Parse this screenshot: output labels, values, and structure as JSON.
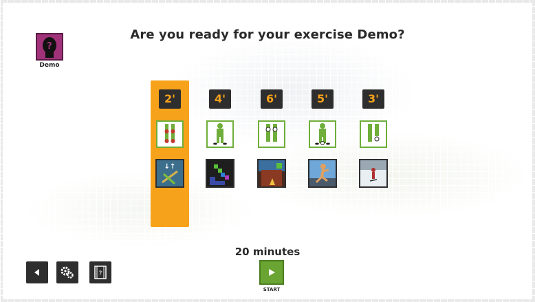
{
  "profile": {
    "name": "Demo",
    "avatar_color": "#a0327a",
    "avatar_icon": "question-head-icon"
  },
  "title": "Are you ready for your exercise Demo?",
  "columns": [
    {
      "duration": "2'",
      "exercise_icon": "legs-weights-icon",
      "game_icon": "game-arrows-icon",
      "selected": true
    },
    {
      "duration": "4'",
      "exercise_icon": "full-body-steps-icon",
      "game_icon": "game-blocks-icon",
      "selected": false
    },
    {
      "duration": "6'",
      "exercise_icon": "knees-markers-icon",
      "game_icon": "game-wall-icon",
      "selected": false
    },
    {
      "duration": "5'",
      "exercise_icon": "full-body-stepper-icon",
      "game_icon": "game-runner-icon",
      "selected": false
    },
    {
      "duration": "3'",
      "exercise_icon": "leg-lift-icon",
      "game_icon": "game-skier-icon",
      "selected": false
    }
  ],
  "total_time": "20 minutes",
  "start": {
    "label": "START",
    "color": "#6aa533"
  },
  "bottom_buttons": [
    "back-icon",
    "settings-icon",
    "film-icon"
  ],
  "colors": {
    "highlight": "#f7a21b",
    "dark": "#2e2e2e",
    "exercise_green": "#6fae3a"
  }
}
